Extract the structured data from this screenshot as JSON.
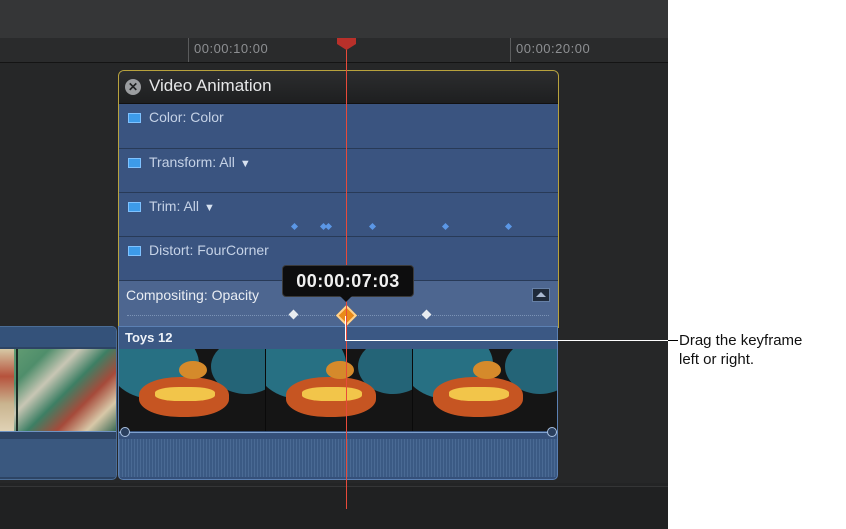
{
  "ruler": {
    "time_1": "00:00:10:00",
    "time_2": "00:00:20:00"
  },
  "animation_panel": {
    "title": "Video Animation",
    "rows": [
      {
        "label": "Color: Color",
        "dropdown": false
      },
      {
        "label": "Transform: All",
        "dropdown": true
      },
      {
        "label": "Trim: All",
        "dropdown": true
      },
      {
        "label": "Distort: FourCorner",
        "dropdown": false
      },
      {
        "label": "Compositing: Opacity",
        "dropdown": false
      }
    ]
  },
  "tooltip": {
    "timecode": "00:00:07:03"
  },
  "clip": {
    "name": "Toys 12"
  },
  "callout": {
    "text": "Drag the keyframe\nleft or right."
  },
  "colors": {
    "playhead": "#e84a3a",
    "selected_keyframe": "#e98a19",
    "panel_border": "#b8a23d"
  },
  "icons": [
    "close-icon",
    "dropdown-triangle-icon",
    "expand-icon",
    "keyframe-icon",
    "playhead-icon"
  ]
}
